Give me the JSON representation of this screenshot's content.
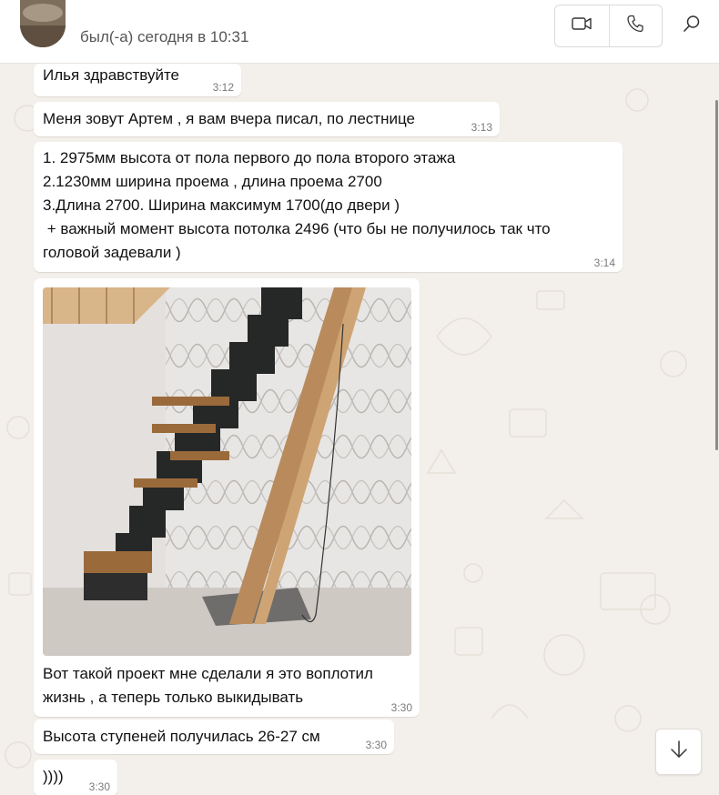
{
  "header": {
    "status": "был(-а) сегодня в 10:31",
    "video_icon": "video-camera-icon",
    "call_icon": "phone-icon",
    "search_icon": "search-icon"
  },
  "messages": [
    {
      "text": "Илья здравствуйте",
      "time": "3:12"
    },
    {
      "text": "Меня зовут Артем , я вам вчера писал, по лестнице",
      "time": "3:13"
    },
    {
      "text": "1. 2975мм высота от пола первого до пола второго этажа\n2.1230мм ширина проема , длина проема 2700\n3.Длина 2700. Ширина максимум 1700(до двери )\n + важный момент высота потолка 2496 (что бы не получилось так что\nголовой задевали )",
      "time": "3:14"
    },
    {
      "caption": "Вот такой проект мне сделали я это воплотил\nжизнь , а теперь только выкидывать",
      "time": "3:30"
    },
    {
      "text": "Высота ступеней получилась 26-27 см",
      "time": "3:30"
    },
    {
      "text": "))))",
      "time": "3:30"
    }
  ],
  "scroll_down_icon": "arrow-down-icon"
}
